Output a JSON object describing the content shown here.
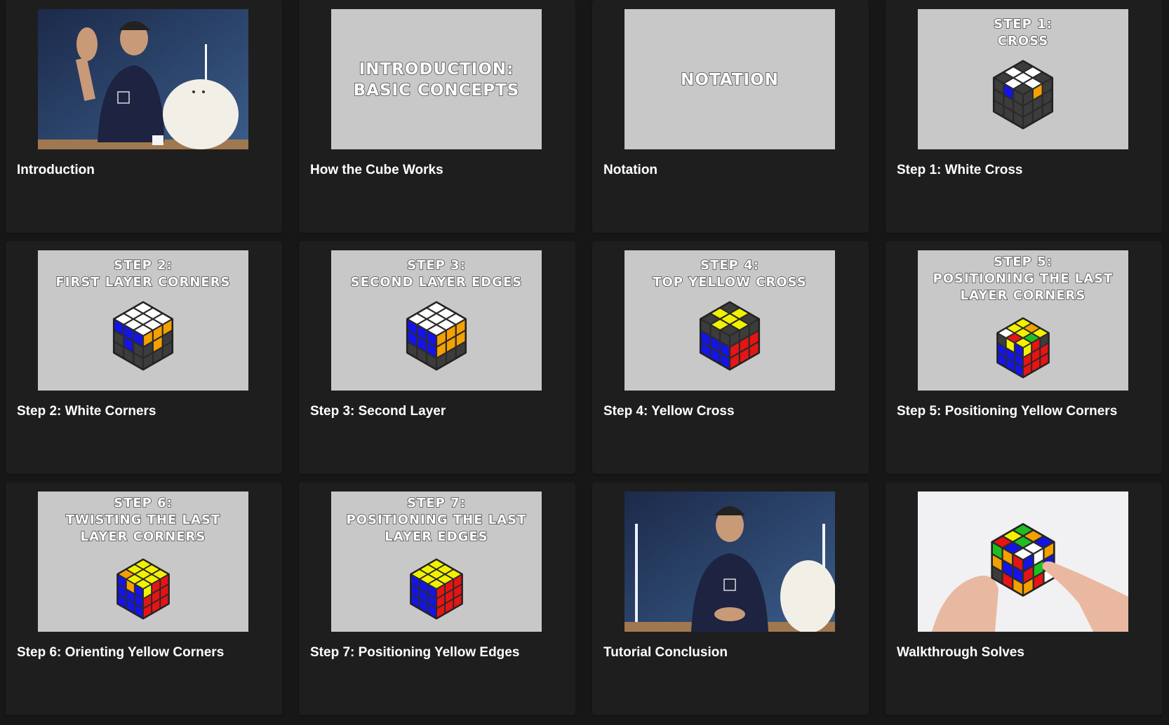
{
  "lessons": [
    {
      "title": "Introduction",
      "thumb": {
        "kind": "photo-presenter",
        "lines": []
      }
    },
    {
      "title": "How the Cube Works",
      "thumb": {
        "kind": "text",
        "lines": [
          "INTRODUCTION:",
          "BASIC CONCEPTS"
        ]
      }
    },
    {
      "title": "Notation",
      "thumb": {
        "kind": "text",
        "lines": [
          "NOTATION"
        ]
      }
    },
    {
      "title": "Step 1: White Cross",
      "thumb": {
        "kind": "cube",
        "lines": [
          "STEP 1:",
          "CROSS"
        ],
        "cube": "cross"
      }
    },
    {
      "title": "Step 2: White Corners",
      "thumb": {
        "kind": "cube",
        "lines": [
          "STEP 2:",
          "FIRST LAYER CORNERS"
        ],
        "cube": "corners"
      }
    },
    {
      "title": "Step 3: Second Layer",
      "thumb": {
        "kind": "cube",
        "lines": [
          "STEP 3:",
          "SECOND LAYER EDGES"
        ],
        "cube": "second"
      }
    },
    {
      "title": "Step 4: Yellow Cross",
      "thumb": {
        "kind": "cube",
        "lines": [
          "STEP 4:",
          "TOP YELLOW CROSS"
        ],
        "cube": "ycross"
      }
    },
    {
      "title": "Step 5: Positioning Yellow Corners",
      "thumb": {
        "kind": "cube",
        "lines": [
          "STEP 5:",
          "POSITIONING THE LAST",
          "LAYER CORNERS"
        ],
        "cube": "poscorners"
      }
    },
    {
      "title": "Step 6: Orienting Yellow Corners",
      "thumb": {
        "kind": "cube",
        "lines": [
          "STEP 6:",
          "TWISTING THE LAST",
          "LAYER CORNERS"
        ],
        "cube": "twist"
      }
    },
    {
      "title": "Step 7: Positioning Yellow Edges",
      "thumb": {
        "kind": "cube",
        "lines": [
          "STEP 7:",
          "POSITIONING THE LAST",
          "LAYER EDGES"
        ],
        "cube": "solved"
      }
    },
    {
      "title": "Tutorial Conclusion",
      "thumb": {
        "kind": "photo-conclusion",
        "lines": []
      }
    },
    {
      "title": "Walkthrough Solves",
      "thumb": {
        "kind": "photo-hands",
        "lines": []
      }
    }
  ],
  "colors": {
    "background": "#171717",
    "card": "#1e1e1e",
    "thumb_gray": "#c8c8c8",
    "cube_white": "#ffffff",
    "cube_yellow": "#f2f200",
    "cube_blue": "#1414e6",
    "cube_orange": "#f5a000",
    "cube_red": "#e61414",
    "cube_green": "#1fbf1f",
    "cube_gray": "#3c3c3c"
  }
}
